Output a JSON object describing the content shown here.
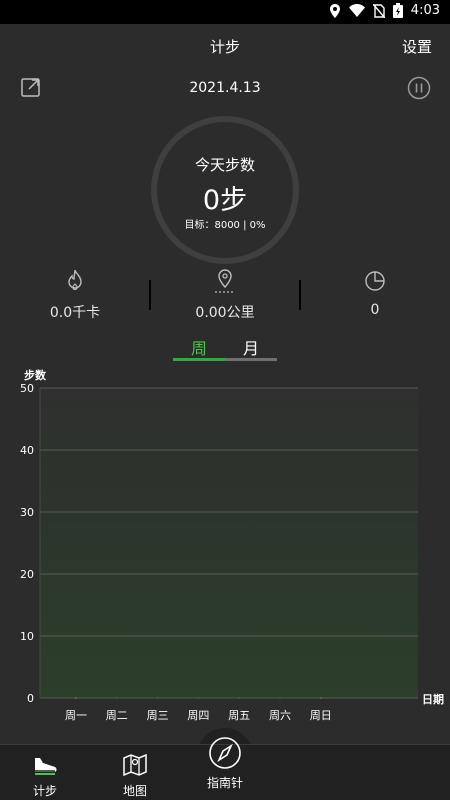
{
  "status_bar": {
    "time": "4:03"
  },
  "header": {
    "title": "计步",
    "settings_label": "设置"
  },
  "date": "2021.4.13",
  "ring": {
    "label": "今天步数",
    "steps": "0步",
    "goal_text": "目标：8000 | 0%"
  },
  "stats": {
    "calories": "0.0千卡",
    "distance": "0.00公里",
    "duration": "0"
  },
  "tabs": {
    "week": "周",
    "month": "月"
  },
  "chart_data": {
    "type": "area",
    "ylabel": "步数",
    "xlabel": "日期",
    "categories": [
      "周一",
      "周二",
      "周三",
      "周四",
      "周五",
      "周六",
      "周日"
    ],
    "values": [
      0,
      0,
      0,
      0,
      0,
      0,
      0
    ],
    "yticks": [
      0,
      10,
      20,
      30,
      40,
      50
    ],
    "ylim": [
      0,
      50
    ],
    "grid": true
  },
  "nav": {
    "items": [
      {
        "label": "计步"
      },
      {
        "label": "地图"
      },
      {
        "label": "指南针"
      }
    ]
  },
  "colors": {
    "accent": "#4cc44c",
    "background": "#2b2c2b",
    "grid": "#5a5b5a"
  }
}
